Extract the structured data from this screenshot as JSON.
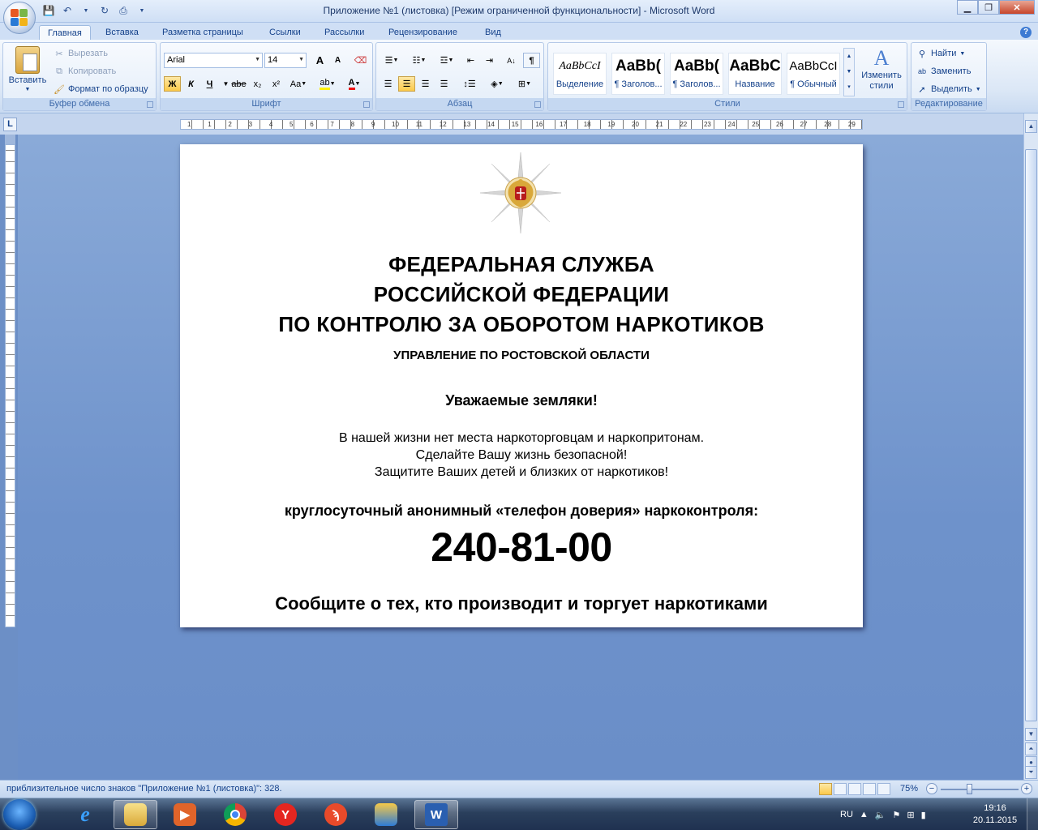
{
  "window": {
    "title": "Приложение №1 (листовка) [Режим ограниченной функциональности] - Microsoft Word"
  },
  "tabs": [
    {
      "label": "Главная",
      "active": true
    },
    {
      "label": "Вставка"
    },
    {
      "label": "Разметка страницы"
    },
    {
      "label": "Ссылки"
    },
    {
      "label": "Рассылки"
    },
    {
      "label": "Рецензирование"
    },
    {
      "label": "Вид"
    }
  ],
  "ribbon": {
    "clipboard": {
      "paste": "Вставить",
      "cut": "Вырезать",
      "copy": "Копировать",
      "format_painter": "Формат по образцу",
      "label": "Буфер обмена"
    },
    "font": {
      "font_name": "Arial",
      "font_size": "14",
      "grow": "A",
      "shrink": "A",
      "bold": "Ж",
      "italic": "К",
      "underline": "Ч",
      "strike": "abe",
      "subscript": "x₂",
      "superscript": "x²",
      "change_case": "Aa",
      "font_color": "A",
      "label": "Шрифт"
    },
    "paragraph": {
      "pilcrow": "¶",
      "label": "Абзац"
    },
    "styles": {
      "items": [
        {
          "preview": "AaBbCcI",
          "name": "Выделение"
        },
        {
          "preview": "AaBb(",
          "name": "¶ Заголов..."
        },
        {
          "preview": "AaBb(",
          "name": "¶ Заголов..."
        },
        {
          "preview": "AaBbC",
          "name": "Название"
        },
        {
          "preview": "AaBbCcI",
          "name": "¶ Обычный"
        }
      ],
      "change_styles": "Изменить стили",
      "label": "Стили"
    },
    "editing": {
      "find": "Найти",
      "replace": "Заменить",
      "select": "Выделить",
      "label": "Редактирование"
    }
  },
  "ruler": {
    "numbers": [
      "1",
      "1",
      "2",
      "3",
      "4",
      "5",
      "6",
      "7",
      "8",
      "9",
      "10",
      "11",
      "12",
      "13",
      "14",
      "15",
      "16",
      "17",
      "18",
      "19",
      "20",
      "21",
      "22",
      "23",
      "24",
      "25",
      "26",
      "27",
      "28",
      "29"
    ]
  },
  "document": {
    "title_lines": [
      "ФЕДЕРАЛЬНАЯ СЛУЖБА",
      "РОССИЙСКОЙ ФЕДЕРАЦИИ",
      "ПО КОНТРОЛЮ ЗА ОБОРОТОМ НАРКОТИКОВ"
    ],
    "subtitle": "УПРАВЛЕНИЕ ПО РОСТОВСКОЙ ОБЛАСТИ",
    "greeting": "Уважаемые земляки!",
    "body_lines": [
      "В нашей жизни нет места наркоторговцам и наркопритонам.",
      "Сделайте Вашу жизнь безопасной!",
      "Защитите Ваших детей и близких от наркотиков!"
    ],
    "hotline": "круглосуточный анонимный «телефон доверия»  наркоконтроля:",
    "phone": "240-81-00",
    "report": "Сообщите о тех, кто производит и торгует наркотиками"
  },
  "statusbar": {
    "text": "приблизительное число знаков \"Приложение №1 (листовка)\": 328.",
    "zoom": "75%",
    "zoom_level_percent": 75
  },
  "taskbar": {
    "language": "RU",
    "time": "19:16",
    "date": "20.11.2015"
  },
  "colors": {
    "ribbon_text": "#15428b",
    "doc_background": "#6c8fc6",
    "highlight_button": "#fbc94a"
  }
}
